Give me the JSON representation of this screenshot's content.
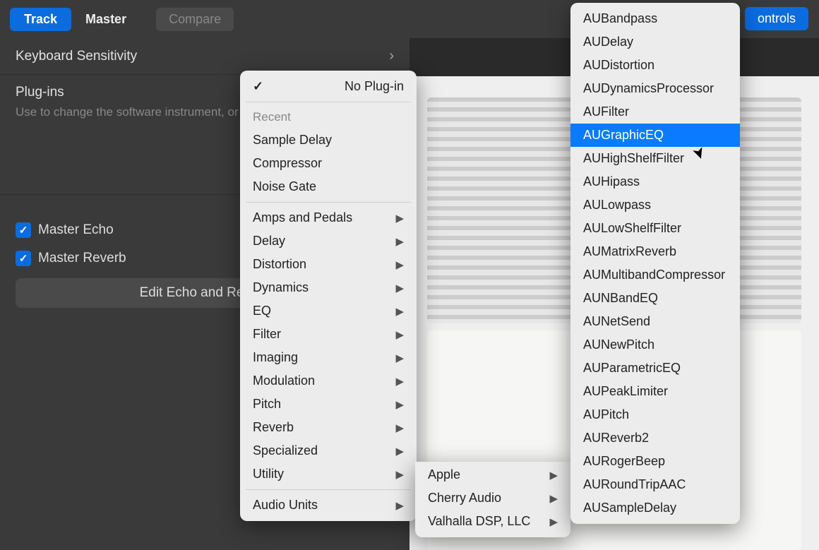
{
  "topbar": {
    "track_tab": "Track",
    "master_tab": "Master",
    "compare": "Compare",
    "controls": "ontrols"
  },
  "sidebar": {
    "keyboard_sensitivity": "Keyboard Sensitivity",
    "plugins_title": "Plug-ins",
    "plugins_desc": "Use to change the software instrument, or sound processing.",
    "master_echo": "Master Echo",
    "master_reverb": "Master Reverb",
    "edit_effects": "Edit Echo and Reverb"
  },
  "menu1": {
    "no_plugin": "No Plug-in",
    "recent_header": "Recent",
    "recent": [
      "Sample Delay",
      "Compressor",
      "Noise Gate"
    ],
    "categories": [
      "Amps and Pedals",
      "Delay",
      "Distortion",
      "Dynamics",
      "EQ",
      "Filter",
      "Imaging",
      "Modulation",
      "Pitch",
      "Reverb",
      "Specialized",
      "Utility"
    ],
    "audio_units": "Audio Units"
  },
  "menu2": {
    "vendors": [
      "Apple",
      "Cherry Audio",
      "Valhalla DSP, LLC"
    ]
  },
  "menu3": {
    "plugins": [
      "AUBandpass",
      "AUDelay",
      "AUDistortion",
      "AUDynamicsProcessor",
      "AUFilter",
      "AUGraphicEQ",
      "AUHighShelfFilter",
      "AUHipass",
      "AULowpass",
      "AULowShelfFilter",
      "AUMatrixReverb",
      "AUMultibandCompressor",
      "AUNBandEQ",
      "AUNetSend",
      "AUNewPitch",
      "AUParametricEQ",
      "AUPeakLimiter",
      "AUPitch",
      "AUReverb2",
      "AURogerBeep",
      "AURoundTripAAC",
      "AUSampleDelay"
    ],
    "highlighted": "AUGraphicEQ"
  }
}
